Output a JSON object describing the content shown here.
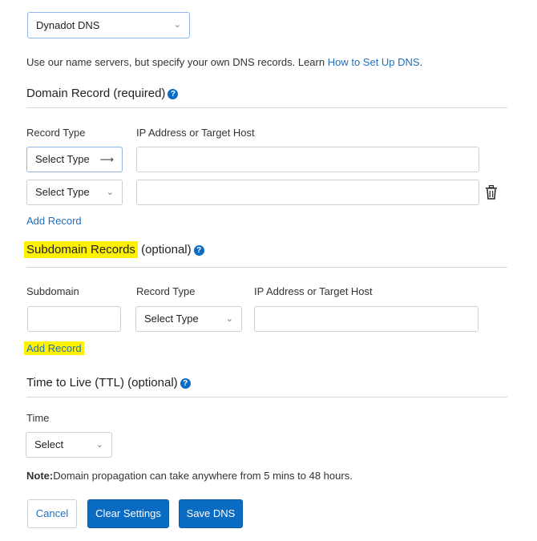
{
  "dns_provider": {
    "selected": "Dynadot DNS"
  },
  "intro": {
    "text": "Use our name servers, but specify your own DNS records. Learn ",
    "link": "How to Set Up DNS",
    "suffix": "."
  },
  "domain_record": {
    "title": "Domain Record (required)",
    "col_type": "Record Type",
    "col_target": "IP Address or Target Host",
    "rows": [
      {
        "type": "Select Type",
        "target": ""
      },
      {
        "type": "Select Type",
        "target": ""
      }
    ],
    "add_label": "Add Record"
  },
  "subdomain_records": {
    "title_highlight": "Subdomain Records",
    "title_rest": " (optional)",
    "col_subdomain": "Subdomain",
    "col_type": "Record Type",
    "col_target": "IP Address or Target Host",
    "row": {
      "subdomain": "",
      "type": "Select Type",
      "target": ""
    },
    "add_label": "Add Record"
  },
  "ttl": {
    "title": "Time to Live (TTL) (optional)",
    "time_label": "Time",
    "selected": "Select"
  },
  "note": {
    "bold": "Note:",
    "text": "Domain propagation can take anywhere from 5 mins to 48 hours."
  },
  "buttons": {
    "cancel": "Cancel",
    "clear": "Clear Settings",
    "save": "Save DNS"
  },
  "colors": {
    "accent": "#0a6bc2",
    "link": "#1f6fbf",
    "highlight": "#fff200"
  },
  "icons": {
    "help": "question-circle-icon",
    "delete": "trash-icon",
    "chevron": "chevron-down-icon"
  }
}
